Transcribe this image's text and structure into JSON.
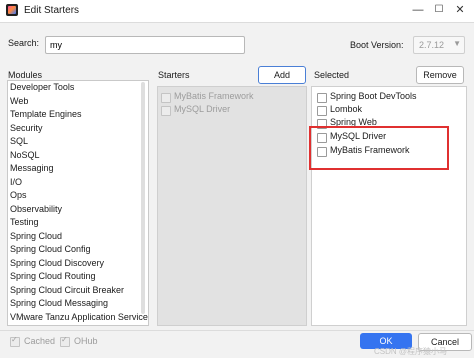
{
  "window": {
    "title": "Edit Starters",
    "minimize": "—",
    "maximize": "☐",
    "close": "✕"
  },
  "search": {
    "label": "Search:",
    "value": "my"
  },
  "boot_version": {
    "label": "Boot Version:",
    "value": "2.7.12"
  },
  "modules": {
    "label": "Modules",
    "items": [
      "Developer Tools",
      "Web",
      "Template Engines",
      "Security",
      "SQL",
      "NoSQL",
      "Messaging",
      "I/O",
      "Ops",
      "Observability",
      "Testing",
      "Spring Cloud",
      "Spring Cloud Config",
      "Spring Cloud Discovery",
      "Spring Cloud Routing",
      "Spring Cloud Circuit Breaker",
      "Spring Cloud Messaging",
      "VMware Tanzu Application Service"
    ]
  },
  "starters": {
    "label": "Starters",
    "add_label": "Add",
    "items": [
      "MyBatis Framework",
      "MySQL Driver"
    ]
  },
  "selected": {
    "label": "Selected",
    "remove_label": "Remove",
    "items": [
      "Spring Boot DevTools",
      "Lombok",
      "Spring Web",
      "MySQL Driver",
      "MyBatis Framework"
    ],
    "highlight_color": "#e03030"
  },
  "footer": {
    "cached_label": "Cached",
    "ohub_label": "OHub",
    "ok_label": "OK",
    "cancel_label": "Cancel",
    "watermark": "CSDN @程序猿小马"
  },
  "colors": {
    "accent": "#3574f0"
  }
}
